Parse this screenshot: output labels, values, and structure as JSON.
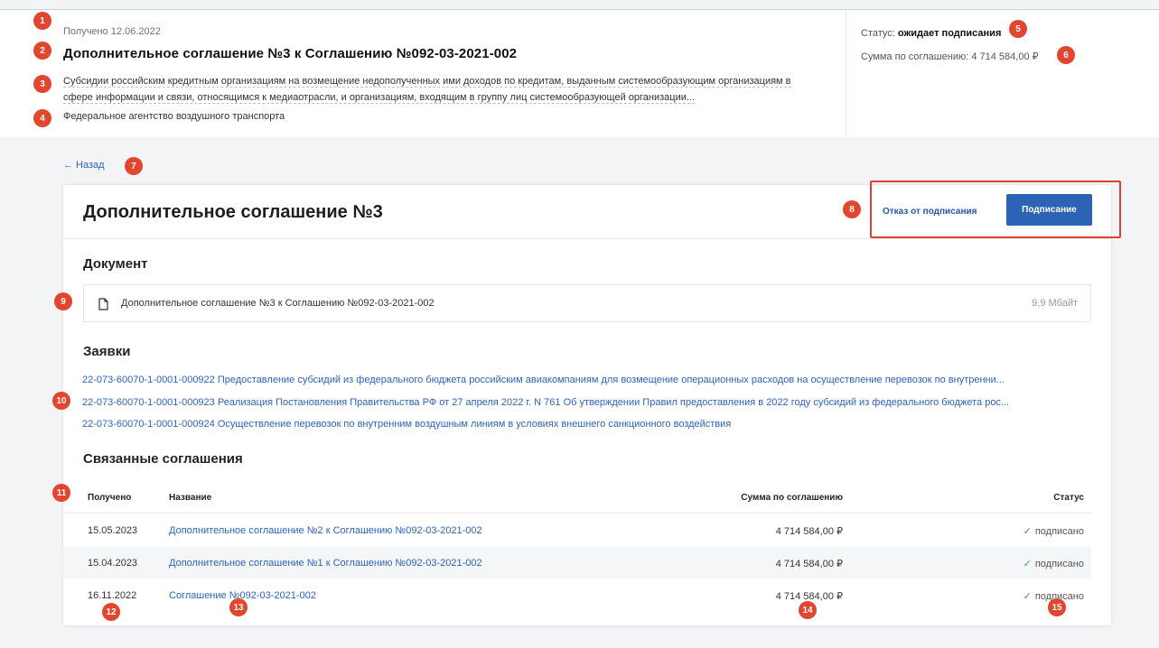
{
  "header": {
    "received": "Получено 12.06.2022",
    "title": "Дополнительное соглашение №3 к Соглашению №092-03-2021-002",
    "description": "Субсидии российским кредитным организациям на возмещение недополученных ими доходов по кредитам, выданным системообразующим организациям в сфере информации и связи, относящимся к медиаотрасли, и организациям, входящим в группу лиц системообразующей организации...",
    "agency": "Федеральное агентство воздушного транспорта",
    "status_label": "Статус:",
    "status_value": "ожидает подписания",
    "sum_label": "Сумма по соглашению:",
    "sum_value": "4 714 584,00 ₽"
  },
  "nav": {
    "back_label": "← Назад"
  },
  "card": {
    "title": "Дополнительное соглашение №3",
    "refuse_label": "Отказ от подписания",
    "sign_label": "Подписание",
    "document_section": "Документ",
    "document": {
      "name": "Дополнительное соглашение №3 к Соглашению №092-03-2021-002",
      "size": "9,9 Мбайт"
    },
    "requests_section": "Заявки",
    "requests": [
      "22-073-60070-1-0001-000922 Предоставление субсидий из федерального бюджета российским авиакомпаниям для возмещение операционных расходов на осуществление перевозок по внутренни...",
      "22-073-60070-1-0001-000923 Реализация Постановления Правительства РФ от 27 апреля 2022 г. N 761 Об утверждении Правил предоставления в 2022 году субсидий из федерального бюджета рос...",
      "22-073-60070-1-0001-000924 Осуществление перевозок по внутренним воздушным линиям в условиях внешнего санкционного воздействия"
    ],
    "related_section": "Связанные соглашения",
    "table": {
      "headers": {
        "date": "Получено",
        "name": "Название",
        "sum": "Сумма по соглашению",
        "status": "Статус"
      },
      "rows": [
        {
          "date": "15.05.2023",
          "name": "Дополнительное соглашение №2 к Соглашению №092-03-2021-002",
          "sum": "4 714 584,00 ₽",
          "status": "подписано"
        },
        {
          "date": "15.04.2023",
          "name": "Дополнительное соглашение №1 к Соглашению №092-03-2021-002",
          "sum": "4 714 584,00 ₽",
          "status": "подписано"
        },
        {
          "date": "16.11.2022",
          "name": "Соглашение №092-03-2021-002",
          "sum": "4 714 584,00 ₽",
          "status": "подписано"
        }
      ]
    }
  },
  "badges": [
    "1",
    "2",
    "3",
    "4",
    "5",
    "6",
    "7",
    "8",
    "9",
    "10",
    "11",
    "12",
    "13",
    "14",
    "15"
  ],
  "colors": {
    "accent": "#2c63b5",
    "link": "#2b63c2",
    "badge": "#e2462e",
    "highlight": "#e0403a",
    "success": "#3a9a55"
  }
}
